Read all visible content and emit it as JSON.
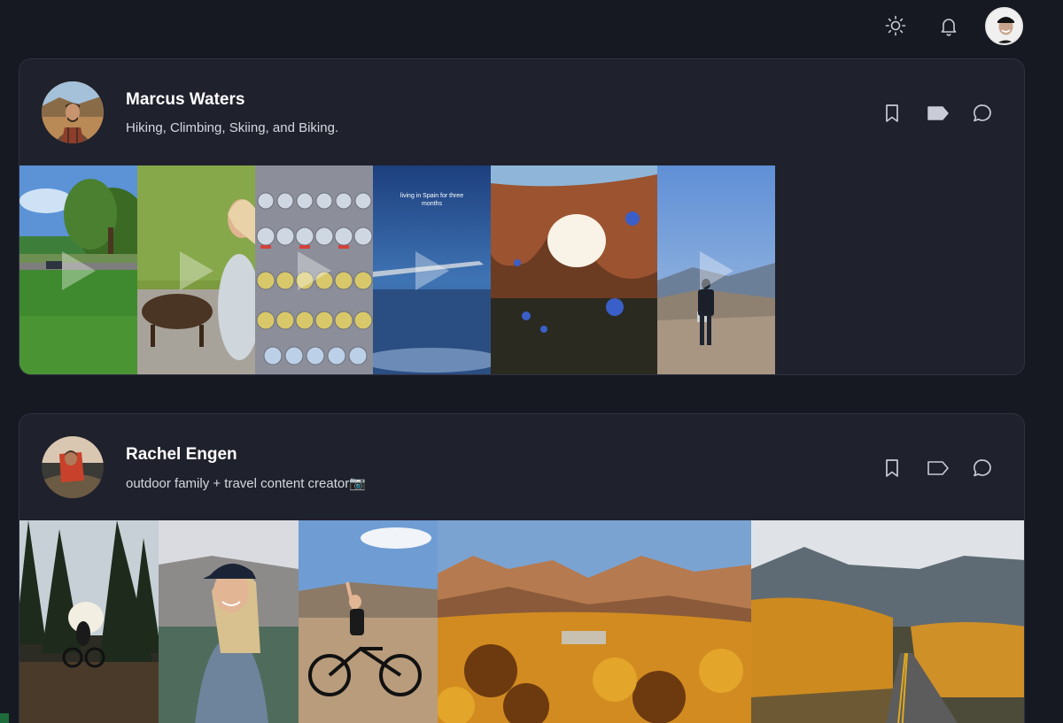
{
  "topbar": {
    "theme_icon": "sun-icon",
    "notifications_icon": "bell-icon",
    "user_avatar": "user-avatar"
  },
  "profiles": [
    {
      "name": "Marcus Waters",
      "bio": "Hiking, Climbing, Skiing, and Biking.",
      "tag_filled": true,
      "tiles": [
        {
          "scene": "park-grass",
          "video": true
        },
        {
          "scene": "girl-dog",
          "video": true
        },
        {
          "scene": "snow-globes",
          "video": true
        },
        {
          "scene": "airplane-sky",
          "video": true,
          "caption": "living in Spain for three months"
        },
        {
          "scene": "arch-rock",
          "video": false
        },
        {
          "scene": "hiker-mountain",
          "video": true
        }
      ]
    },
    {
      "name": "Rachel Engen",
      "bio": "outdoor family + travel content creator📷",
      "tag_filled": false,
      "tiles": [
        {
          "scene": "forest-biker"
        },
        {
          "scene": "woman-cap"
        },
        {
          "scene": "bike-desert"
        },
        {
          "scene": "autumn-valley"
        },
        {
          "scene": "autumn-road"
        }
      ]
    }
  ],
  "colors": {
    "background": "#171922",
    "card": "#1f212c",
    "icon": "#c9ccd6"
  }
}
